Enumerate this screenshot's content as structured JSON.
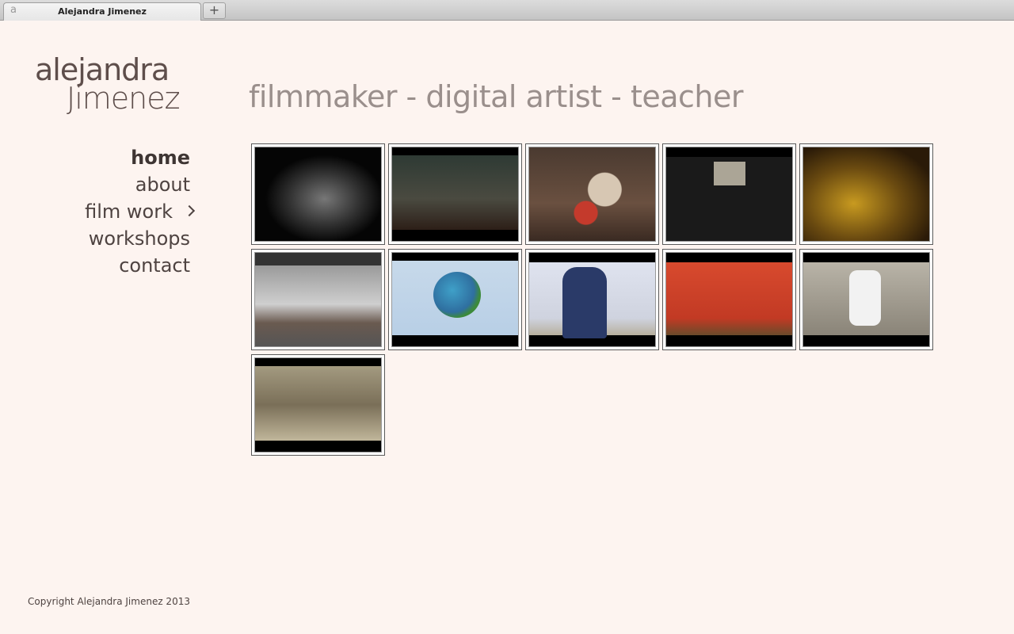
{
  "browser": {
    "tab_title": "Alejandra Jimenez",
    "tab_favicon": "a",
    "new_tab_label": "+"
  },
  "logo": {
    "line1": "alejandra",
    "line2": "Jimenez"
  },
  "tagline": "filmmaker - digital artist - teacher",
  "nav": {
    "items": [
      {
        "label": "home"
      },
      {
        "label": "about"
      },
      {
        "label": "film work"
      },
      {
        "label": "workshops"
      },
      {
        "label": "contact"
      }
    ],
    "active": "home"
  },
  "gallery": {
    "thumbnail_count": 11
  },
  "footer": {
    "copyright": "Copyright Alejandra Jimenez 2013"
  },
  "colors": {
    "background": "#fdf4f0",
    "text": "#4e4341",
    "tagline": "#9a8f8c"
  }
}
